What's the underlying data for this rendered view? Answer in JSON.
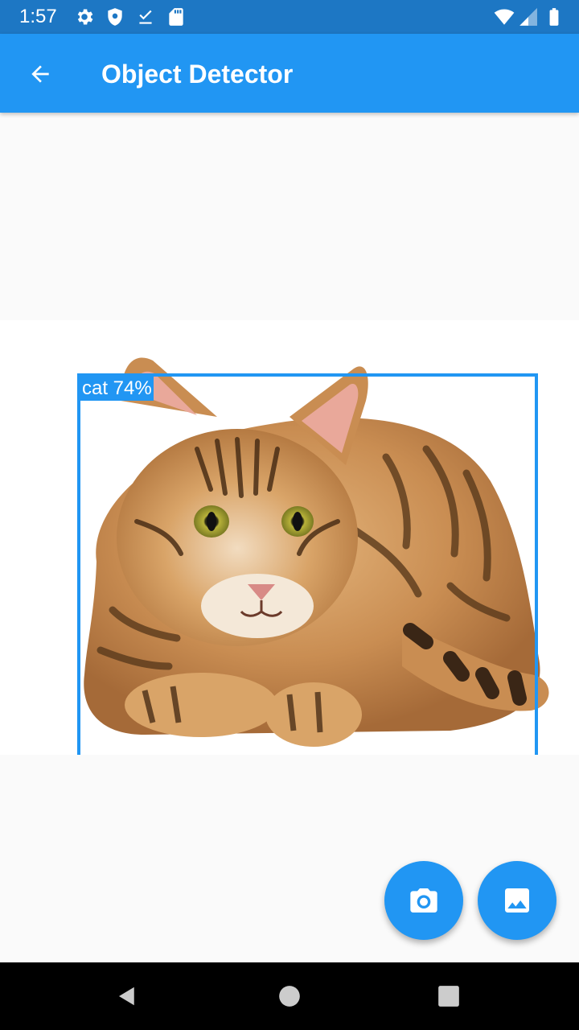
{
  "status_bar": {
    "time": "1:57",
    "left_icons": [
      "gear-icon",
      "shield-icon",
      "download-done-icon",
      "sd-card-icon"
    ],
    "right_icons": [
      "wifi-icon",
      "signal-icon",
      "battery-icon"
    ]
  },
  "app_bar": {
    "title": "Object Detector",
    "back_icon": "arrow-back-icon"
  },
  "detection": {
    "label": "cat 74%",
    "class": "cat",
    "confidence_percent": 74
  },
  "fabs": [
    {
      "name": "camera",
      "icon": "camera-icon"
    },
    {
      "name": "gallery",
      "icon": "image-icon"
    }
  ],
  "nav_bar": [
    "back-triangle-icon",
    "home-circle-icon",
    "recents-square-icon"
  ],
  "colors": {
    "primary": "#2196f3",
    "status_bar": "#1d77c4",
    "nav_bar": "#000000",
    "background": "#fafafa"
  }
}
